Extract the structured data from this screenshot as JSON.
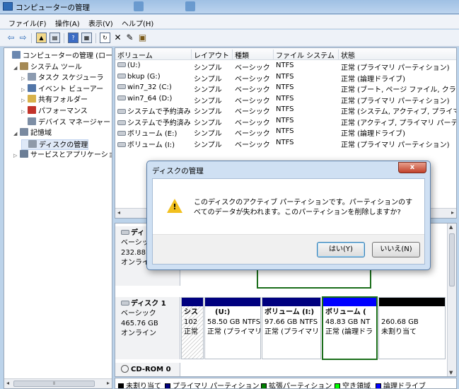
{
  "window": {
    "title": "コンピューターの管理"
  },
  "menu": [
    "ファイル(F)",
    "操作(A)",
    "表示(V)",
    "ヘルプ(H)"
  ],
  "tree": [
    {
      "label": "コンピューターの管理 (ローカ",
      "indent": 0,
      "exp": "",
      "icon": "computer-icon",
      "color": "#6b88b0"
    },
    {
      "label": "システム ツール",
      "indent": 1,
      "exp": "◢",
      "icon": "tools-icon",
      "color": "#a58a55"
    },
    {
      "label": "タスク スケジューラ",
      "indent": 2,
      "exp": "▷",
      "icon": "clock-icon",
      "color": "#8c9bb0"
    },
    {
      "label": "イベント ビューアー",
      "indent": 2,
      "exp": "▷",
      "icon": "event-viewer-icon",
      "color": "#5276a8"
    },
    {
      "label": "共有フォルダー",
      "indent": 2,
      "exp": "▷",
      "icon": "shared-folder-icon",
      "color": "#d8b24a"
    },
    {
      "label": "パフォーマンス",
      "indent": 2,
      "exp": "▷",
      "icon": "performance-icon",
      "color": "#c2332a"
    },
    {
      "label": "デバイス マネージャー",
      "indent": 2,
      "exp": "",
      "icon": "device-manager-icon",
      "color": "#7d8ea5"
    },
    {
      "label": "記憶域",
      "indent": 1,
      "exp": "◢",
      "icon": "storage-icon",
      "color": "#7a8aa0"
    },
    {
      "label": "ディスクの管理",
      "indent": 2,
      "exp": "",
      "icon": "disk-management-icon",
      "color": "#8f9aa8",
      "selected": true
    },
    {
      "label": "サービスとアプリケーション",
      "indent": 1,
      "exp": "▷",
      "icon": "services-icon",
      "color": "#6c7e96"
    }
  ],
  "volume_table": {
    "headers": [
      "ボリューム",
      "レイアウト",
      "種類",
      "ファイル システム",
      "状態"
    ],
    "rows": [
      [
        "(U:)",
        "シンプル",
        "ベーシック",
        "NTFS",
        "正常 (プライマリ パーティション)"
      ],
      [
        "bkup (G:)",
        "シンプル",
        "ベーシック",
        "NTFS",
        "正常 (論理ドライブ)"
      ],
      [
        "win7_32 (C:)",
        "シンプル",
        "ベーシック",
        "NTFS",
        "正常 (ブート, ページ ファイル, クラ"
      ],
      [
        "win7_64 (D:)",
        "シンプル",
        "ベーシック",
        "NTFS",
        "正常 (プライマリ パーティション)"
      ],
      [
        "システムで予約済み",
        "シンプル",
        "ベーシック",
        "NTFS",
        "正常 (システム, アクティブ, プライマ"
      ],
      [
        "システムで予約済み",
        "シンプル",
        "ベーシック",
        "NTFS",
        "正常 (アクティブ, プライマリ パーテ"
      ],
      [
        "ボリューム (E:)",
        "シンプル",
        "ベーシック",
        "NTFS",
        "正常 (論理ドライブ)"
      ],
      [
        "ボリューム (I:)",
        "シンプル",
        "ベーシック",
        "NTFS",
        "正常 (プライマリ パーティション)"
      ]
    ]
  },
  "disk0": {
    "name": "ディ",
    "type": "ベーシック",
    "size": "232.88",
    "status": "オンライ"
  },
  "disk1": {
    "name": "ディスク 1",
    "type": "ベーシック",
    "size": "465.76 GB",
    "status": "オンライン",
    "partitions": [
      {
        "title": "シス",
        "line1": "102",
        "line2": "正常"
      },
      {
        "title": "(U:)",
        "line1": "58.50 GB NTFS",
        "line2": "正常 (プライマリ"
      },
      {
        "title": "ボリューム (I:)",
        "line1": "97.66 GB NTFS",
        "line2": "正常 (プライマリ"
      },
      {
        "title": "ボリューム (",
        "line1": "48.83 GB NT",
        "line2": "正常 (論理ドラ"
      },
      {
        "title": "",
        "line1": "260.68 GB",
        "line2": "未割り当て"
      }
    ]
  },
  "cdrom": {
    "name": "CD-ROM 0"
  },
  "legend": [
    {
      "label": "未割り当て",
      "color": "#000000"
    },
    {
      "label": "プライマリ パーティション",
      "color": "#00007f"
    },
    {
      "label": "拡張パーティション",
      "color": "#007f00"
    },
    {
      "label": "空き領域",
      "color": "#00ff00"
    },
    {
      "label": "論理ドライブ",
      "color": "#0000ff"
    }
  ],
  "dialog": {
    "title": "ディスクの管理",
    "close_label": "x",
    "message": "このディスクのアクティブ パーティションです。パーティションのすべてのデータが失われます。このパーティションを削除しますか?",
    "yes_label": "はい(Y)",
    "no_label": "いいえ(N)"
  }
}
